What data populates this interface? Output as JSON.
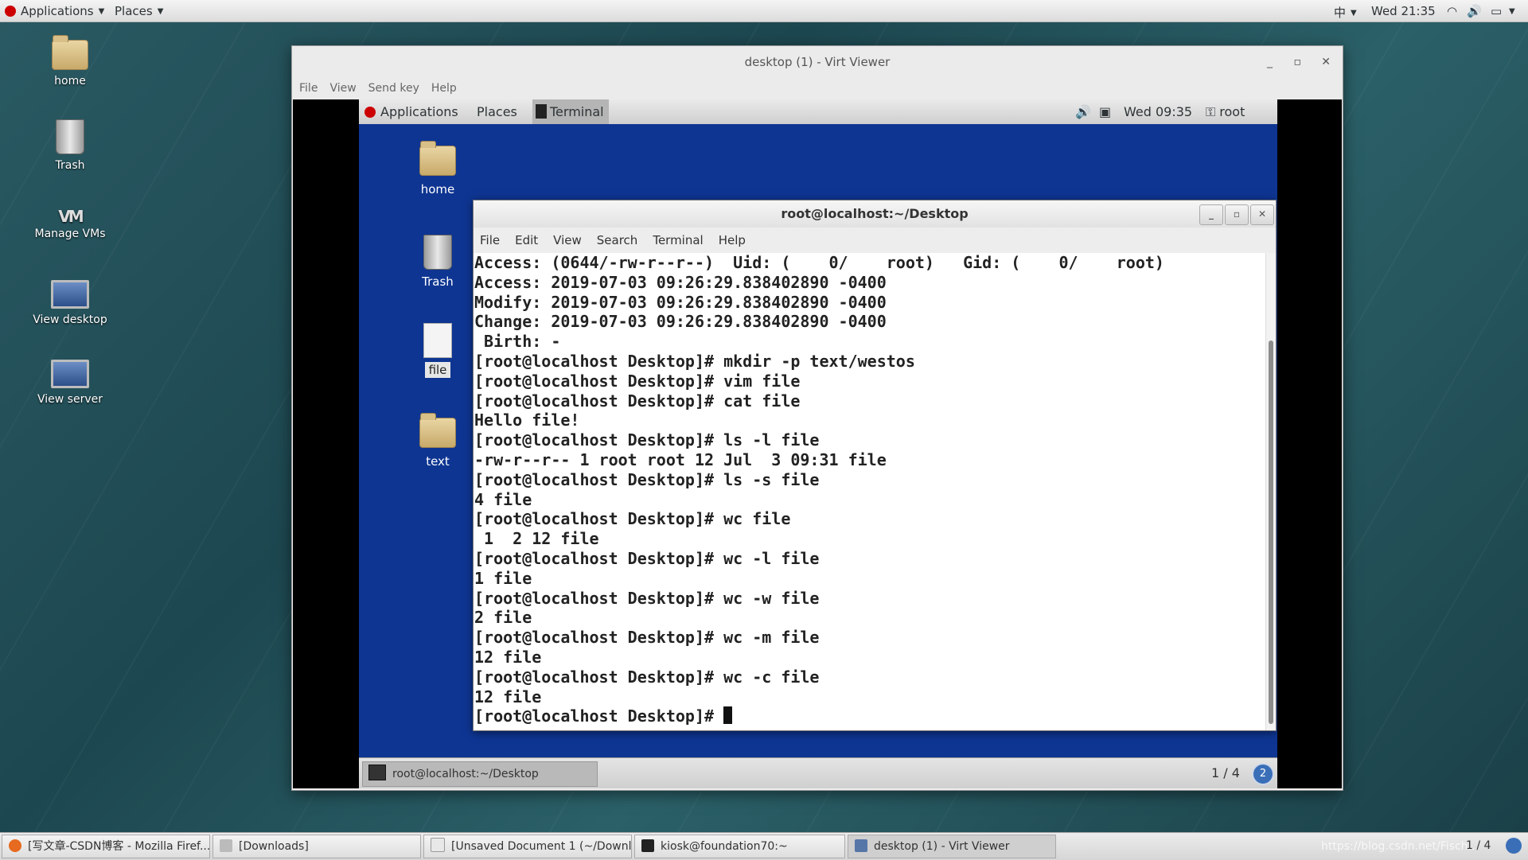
{
  "host_top": {
    "applications": "Applications",
    "places": "Places",
    "input_method": "中",
    "clock": "Wed 21:35"
  },
  "desktop_icons": [
    "home",
    "Trash",
    "Manage VMs",
    "View desktop",
    "View server"
  ],
  "virt_viewer": {
    "title": "desktop (1) - Virt Viewer",
    "menu": [
      "File",
      "View",
      "Send key",
      "Help"
    ]
  },
  "guest": {
    "top": {
      "applications": "Applications",
      "places": "Places",
      "terminal": "Terminal",
      "clock": "Wed 09:35",
      "user": "root"
    },
    "desktop_icons": [
      "home",
      "Trash",
      "file",
      "text"
    ],
    "terminal": {
      "title": "root@localhost:~/Desktop",
      "menu": [
        "File",
        "Edit",
        "View",
        "Search",
        "Terminal",
        "Help"
      ],
      "lines": [
        "Access: (0644/-rw-r--r--)  Uid: (    0/    root)   Gid: (    0/    root)",
        "Access: 2019-07-03 09:26:29.838402890 -0400",
        "Modify: 2019-07-03 09:26:29.838402890 -0400",
        "Change: 2019-07-03 09:26:29.838402890 -0400",
        " Birth: -",
        "[root@localhost Desktop]# mkdir -p text/westos",
        "[root@localhost Desktop]# vim file",
        "[root@localhost Desktop]# cat file",
        "Hello file!",
        "[root@localhost Desktop]# ls -l file",
        "-rw-r--r-- 1 root root 12 Jul  3 09:31 file",
        "[root@localhost Desktop]# ls -s file",
        "4 file",
        "[root@localhost Desktop]# wc file",
        " 1  2 12 file",
        "[root@localhost Desktop]# wc -l file",
        "1 file",
        "[root@localhost Desktop]# wc -w file",
        "2 file",
        "[root@localhost Desktop]# wc -m file",
        "12 file",
        "[root@localhost Desktop]# wc -c file",
        "12 file"
      ],
      "prompt": "[root@localhost Desktop]# "
    },
    "bottom": {
      "task": "root@localhost:~/Desktop",
      "workspace": "1 / 4",
      "badge": "2"
    }
  },
  "host_taskbar": {
    "items": [
      "[写文章-CSDN博客 - Mozilla Firef...",
      "[Downloads]",
      "[Unsaved Document 1 (~/Downlo...",
      "kiosk@foundation70:~",
      "desktop (1) - Virt Viewer"
    ],
    "workspace": "1 / 4",
    "watermark": "https://blog.csdn.net/Fisch..."
  }
}
